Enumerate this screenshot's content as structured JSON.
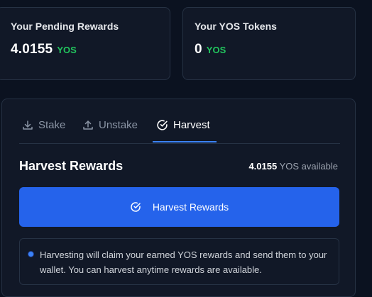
{
  "pending_rewards": {
    "label": "Your Pending Rewards",
    "value": "4.0155",
    "unit": "YOS"
  },
  "yos_tokens": {
    "label": "Your YOS Tokens",
    "value": "0",
    "unit": "YOS"
  },
  "tabs": [
    {
      "label": "Stake",
      "icon": "download-icon"
    },
    {
      "label": "Unstake",
      "icon": "upload-icon"
    },
    {
      "label": "Harvest",
      "icon": "check-circle-icon",
      "active": true
    }
  ],
  "harvest": {
    "title": "Harvest Rewards",
    "available_amount": "4.0155",
    "available_suffix": "YOS available",
    "button_label": "Harvest Rewards",
    "info_text": "Harvesting will claim your earned YOS rewards and send them to your wallet. You can harvest anytime rewards are available."
  },
  "colors": {
    "accent": "#2563eb",
    "token_green": "#22c55e",
    "background": "#0b1220",
    "card": "#111827"
  }
}
